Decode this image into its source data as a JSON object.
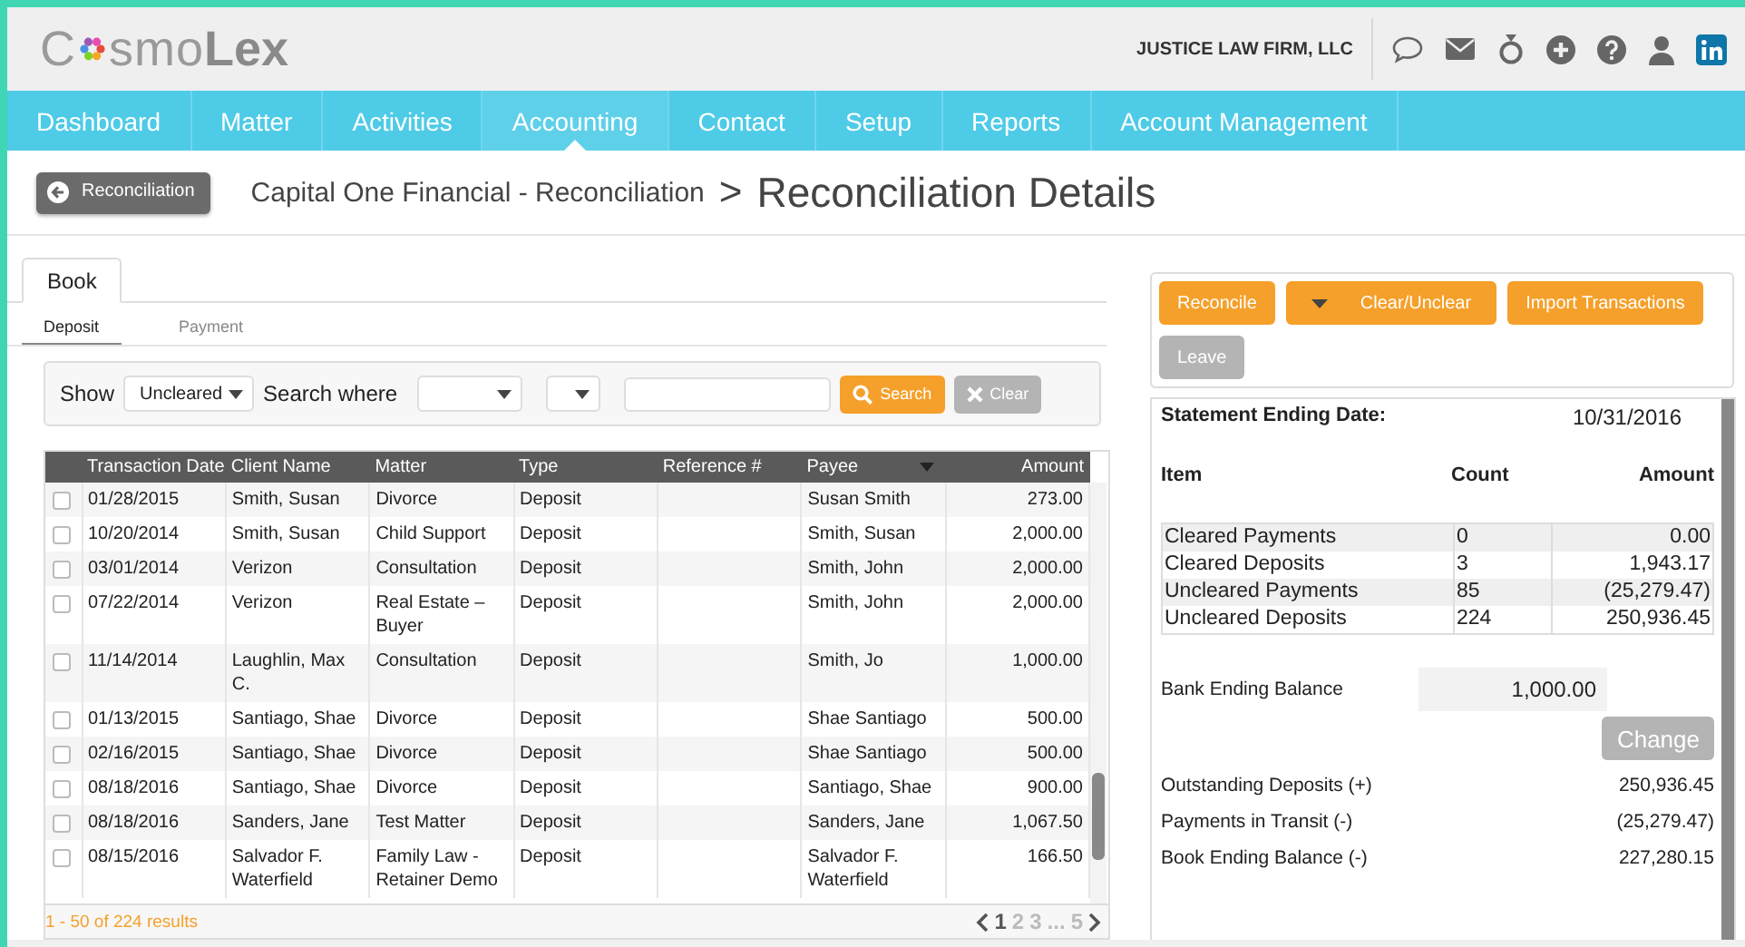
{
  "header": {
    "logo": {
      "first": "C",
      "middle": "smo",
      "last": "Lex"
    },
    "firm": "JUSTICE LAW FIRM, LLC"
  },
  "nav": [
    {
      "label": "Dashboard",
      "selected": false
    },
    {
      "label": "Matter",
      "selected": false
    },
    {
      "label": "Activities",
      "selected": false
    },
    {
      "label": "Accounting",
      "selected": true
    },
    {
      "label": "Contact",
      "selected": false
    },
    {
      "label": "Setup",
      "selected": false
    },
    {
      "label": "Reports",
      "selected": false
    },
    {
      "label": "Account Management",
      "selected": false
    }
  ],
  "page": {
    "back_button": "Reconciliation",
    "breadcrumb": "Capital One Financial - Reconciliation",
    "separator": ">",
    "title": "Reconciliation Details"
  },
  "tabs": [
    {
      "label": "Book",
      "selected": true
    }
  ],
  "subtabs": [
    {
      "label": "Deposit",
      "selected": true
    },
    {
      "label": "Payment",
      "selected": false
    }
  ],
  "filter": {
    "show_label": "Show",
    "show_value": "Uncleared",
    "search_where_label": "Search where",
    "search_button": "Search",
    "clear_button": "Clear"
  },
  "table": {
    "columns": [
      "Transaction Date",
      "Client Name",
      "Matter",
      "Type",
      "Reference #",
      "Payee",
      "Amount"
    ],
    "rows": [
      {
        "checked": false,
        "cells": [
          "01/28/2015",
          "Smith, Susan",
          "Divorce",
          "Deposit",
          "",
          "Susan Smith",
          "273.00"
        ]
      },
      {
        "checked": false,
        "cells": [
          "10/20/2014",
          "Smith, Susan",
          "Child Support",
          "Deposit",
          "",
          "Smith, Susan",
          "2,000.00"
        ]
      },
      {
        "checked": false,
        "cells": [
          "03/01/2014",
          "Verizon",
          "Consultation",
          "Deposit",
          "",
          "Smith, John",
          "2,000.00"
        ]
      },
      {
        "checked": false,
        "cells": [
          "07/22/2014",
          "Verizon",
          "Real Estate – Buyer",
          "Deposit",
          "",
          "Smith, John",
          "2,000.00"
        ]
      },
      {
        "checked": false,
        "cells": [
          "11/14/2014",
          "Laughlin, Max C.",
          "Consultation",
          "Deposit",
          "",
          "Smith, Jo",
          "1,000.00"
        ]
      },
      {
        "checked": false,
        "cells": [
          "01/13/2015",
          "Santiago, Shae",
          "Divorce",
          "Deposit",
          "",
          "Shae Santiago",
          "500.00"
        ]
      },
      {
        "checked": false,
        "cells": [
          "02/16/2015",
          "Santiago, Shae",
          "Divorce",
          "Deposit",
          "",
          "Shae Santiago",
          "500.00"
        ]
      },
      {
        "checked": false,
        "cells": [
          "08/18/2016",
          "Santiago, Shae",
          "Divorce",
          "Deposit",
          "",
          "Santiago, Shae",
          "900.00"
        ]
      },
      {
        "checked": false,
        "cells": [
          "08/18/2016",
          "Sanders, Jane",
          "Test Matter",
          "Deposit",
          "",
          "Sanders, Jane",
          "1,067.50"
        ]
      },
      {
        "checked": false,
        "cells": [
          "08/15/2016",
          "Salvador F. Waterfield",
          "Family Law - Retainer Demo",
          "Deposit",
          "",
          "Salvador F. Waterfield",
          "166.50"
        ]
      }
    ],
    "results": "1 - 50 of 224 results",
    "pages": [
      {
        "label": "1",
        "selected": true
      },
      {
        "label": "2",
        "selected": false
      },
      {
        "label": "3",
        "selected": false
      },
      {
        "label": "...",
        "selected": false
      },
      {
        "label": "5",
        "selected": false
      }
    ]
  },
  "actions": [
    {
      "label": "Reconcile",
      "kind": "primary"
    },
    {
      "label": "Clear/Unclear",
      "kind": "dropdown"
    },
    {
      "label": "Import Transactions",
      "kind": "primary"
    },
    {
      "label": "Leave",
      "kind": "disabled"
    }
  ],
  "summary": {
    "statement_label": "Statement Ending Date:",
    "statement_date": "10/31/2016",
    "columns": [
      "Item",
      "Count",
      "Amount"
    ],
    "rows": [
      {
        "item": "Cleared Payments",
        "count": "0",
        "amount": "0.00"
      },
      {
        "item": "Cleared Deposits",
        "count": "3",
        "amount": "1,943.17"
      },
      {
        "item": "Uncleared Payments",
        "count": "85",
        "amount": "(25,279.47)"
      },
      {
        "item": "Uncleared Deposits",
        "count": "224",
        "amount": "250,936.45"
      }
    ],
    "bank_label": "Bank Ending Balance",
    "bank_value": "1,000.00",
    "change_button": "Change",
    "totals": [
      {
        "label": "Outstanding Deposits (+)",
        "value": "250,936.45"
      },
      {
        "label": "Payments in Transit (-)",
        "value": "(25,279.47)"
      },
      {
        "label": "Book Ending Balance (-)",
        "value": "227,280.15"
      }
    ]
  }
}
